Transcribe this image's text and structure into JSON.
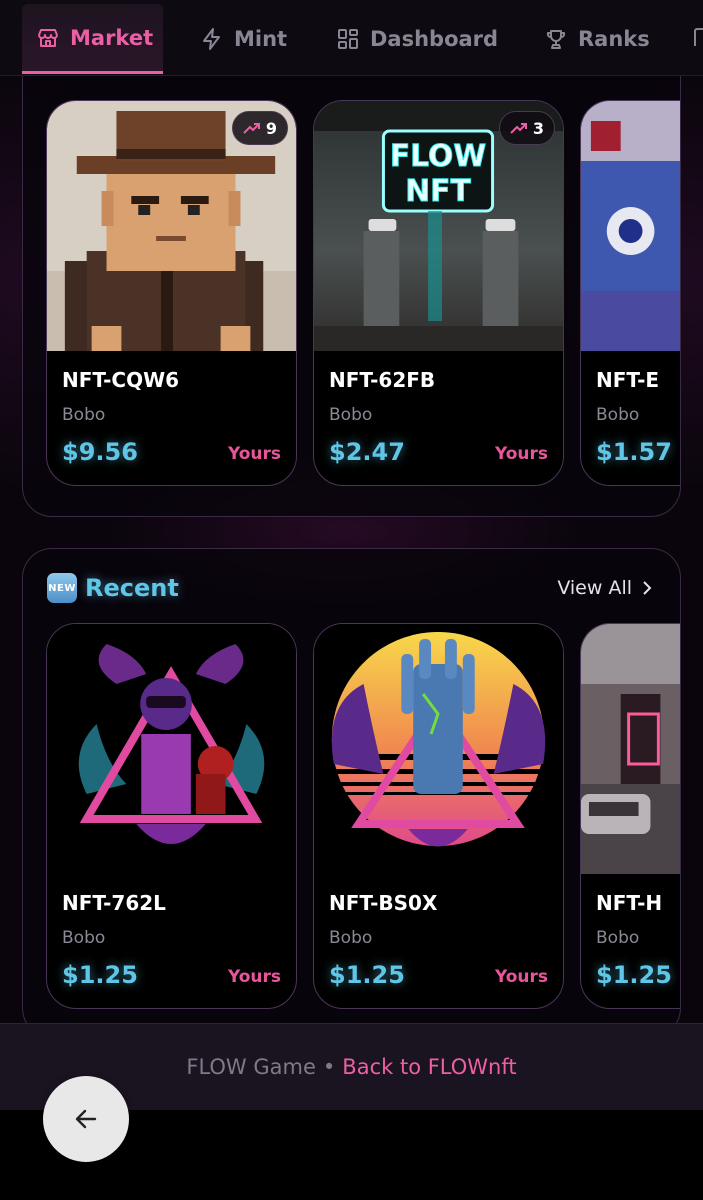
{
  "nav": {
    "tabs": [
      {
        "label": "Market",
        "icon": "store-icon",
        "active": true
      },
      {
        "label": "Mint",
        "icon": "lightning-icon",
        "active": false
      },
      {
        "label": "Dashboard",
        "icon": "grid-icon",
        "active": false
      },
      {
        "label": "Ranks",
        "icon": "trophy-icon",
        "active": false
      }
    ]
  },
  "trending": {
    "cards": [
      {
        "name": "NFT-CQW6",
        "creator": "Bobo",
        "price": "$9.56",
        "owner": "Yours",
        "badge": "9",
        "art": "pixel-cowboy"
      },
      {
        "name": "NFT-62FB",
        "creator": "Bobo",
        "price": "$2.47",
        "owner": "Yours",
        "badge": "3",
        "art": "flow-nft-gas-station"
      },
      {
        "name": "NFT-E",
        "creator": "Bobo",
        "price": "$1.57",
        "owner": "",
        "badge": "",
        "art": "blue-fabric-collage"
      }
    ]
  },
  "recent": {
    "title": "Recent",
    "badge_icon": "NEW",
    "view_all": "View All",
    "cards": [
      {
        "name": "NFT-762L",
        "creator": "Bobo",
        "price": "$1.25",
        "owner": "Yours",
        "art": "cyber-girl-triangle"
      },
      {
        "name": "NFT-BS0X",
        "creator": "Bobo",
        "price": "$1.25",
        "owner": "Yours",
        "art": "robot-hand-sunset"
      },
      {
        "name": "NFT-H",
        "creator": "Bobo",
        "price": "$1.25",
        "owner": "",
        "art": "neon-street-car"
      }
    ]
  },
  "footer": {
    "text": "FLOW Game",
    "separator": "•",
    "link": "Back to FLOWnft"
  },
  "colors": {
    "accent_pink": "#ec5fa4",
    "price_cyan": "#5fc6e8",
    "background": "#0a050c"
  }
}
